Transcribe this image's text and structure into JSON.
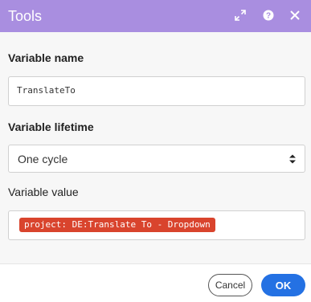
{
  "dialog": {
    "title": "Tools",
    "header_color": "#a98ee0",
    "icons": [
      "expand-icon",
      "help-icon",
      "close-icon"
    ]
  },
  "form": {
    "variable_name_label": "Variable name",
    "variable_name_value": "TranslateTo",
    "variable_lifetime_label": "Variable lifetime",
    "variable_lifetime_value": "One cycle",
    "variable_value_label": "Variable value",
    "variable_value_token": "project: DE:Translate To - Dropdown",
    "token_color": "#d9442d"
  },
  "footer": {
    "cancel_label": "Cancel",
    "ok_label": "OK",
    "ok_color": "#2471e3"
  }
}
